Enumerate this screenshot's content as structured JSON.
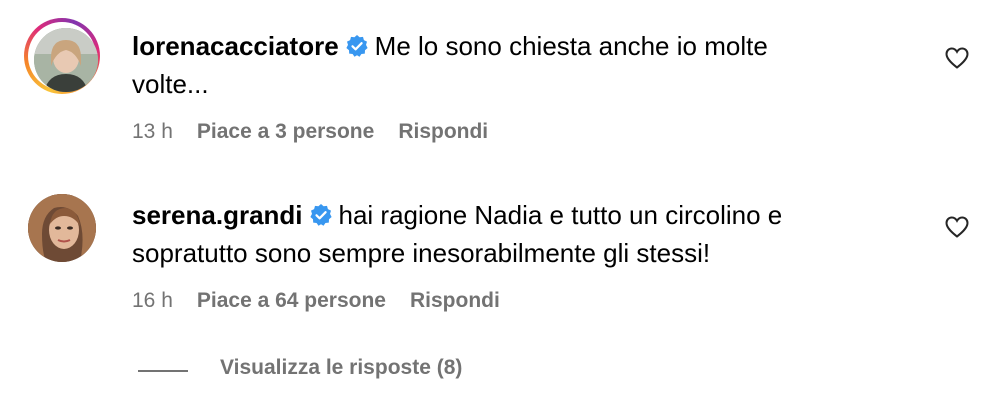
{
  "comments": [
    {
      "username": "lorenacacciatore",
      "text_line1": "Me lo sono chiesta anche io molte",
      "text_line2": "volte...",
      "time": "13 h",
      "likes": "Piace a 3 persone",
      "reply": "Rispondi"
    },
    {
      "username": "serena.grandi",
      "text_line1": "hai ragione Nadia e tutto un circolino e",
      "text_line2": "sopratutto sono sempre inesorabilmente gli stessi!",
      "time": "16 h",
      "likes": "Piace a 64 persone",
      "reply": "Rispondi"
    }
  ],
  "view_replies": "Visualizza le risposte (8)",
  "colors": {
    "verified": "#3897f0",
    "meta": "#737373"
  }
}
